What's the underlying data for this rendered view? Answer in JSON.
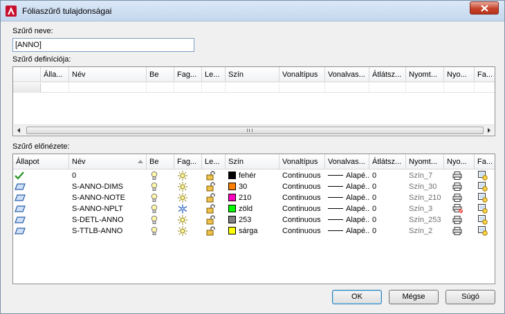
{
  "window": {
    "title": "Fóliaszűrő tulajdonságai",
    "close_icon": "close-icon",
    "app_icon": "autocad-logo-icon"
  },
  "filter_name": {
    "label": "Szűrő neve:",
    "value": "[ANNO]"
  },
  "definition": {
    "label": "Szűrő definíciója:",
    "columns": [
      "",
      "Álla...",
      "Név",
      "Be",
      "Fag...",
      "Le...",
      "Szín",
      "Vonaltípus",
      "Vonalvas...",
      "Átlátsz...",
      "Nyomt...",
      "Nyo...",
      "Fa..."
    ]
  },
  "preview": {
    "label": "Szűrő előnézete:",
    "columns": [
      "Állapot",
      "Név",
      "Be",
      "Fag...",
      "Le...",
      "Szín",
      "Vonaltípus",
      "Vonalvas...",
      "Átlátsz...",
      "Nyomt...",
      "Nyo...",
      "Fa..."
    ],
    "rows": [
      {
        "status": "current-check-icon",
        "name": "0",
        "color_hex": "#000000",
        "color": "fehér",
        "linetype": "Continuous",
        "lineweight": "Alapé...",
        "transparency": "0",
        "plot_style": "Szín_7",
        "plot": "printer-icon",
        "frozen_icon": "sun-icon"
      },
      {
        "status": "layer-icon",
        "name": "S-ANNO-DIMS",
        "color_hex": "#ff7f00",
        "color": "30",
        "linetype": "Continuous",
        "lineweight": "Alapé...",
        "transparency": "0",
        "plot_style": "Szín_30",
        "plot": "printer-icon",
        "frozen_icon": "sun-icon"
      },
      {
        "status": "layer-icon",
        "name": "S-ANNO-NOTE",
        "color_hex": "#ff00bf",
        "color": "210",
        "linetype": "Continuous",
        "lineweight": "Alapé...",
        "transparency": "0",
        "plot_style": "Szín_210",
        "plot": "printer-icon",
        "frozen_icon": "sun-icon"
      },
      {
        "status": "layer-icon",
        "name": "S-ANNO-NPLT",
        "color_hex": "#00ff00",
        "color": "zöld",
        "linetype": "Continuous",
        "lineweight": "Alapé...",
        "transparency": "0",
        "plot_style": "Szín_3",
        "plot": "no-plot-printer-icon",
        "frozen_icon": "snowflake-icon"
      },
      {
        "status": "layer-icon",
        "name": "S-DETL-ANNO",
        "color_hex": "#808080",
        "color": "253",
        "linetype": "Continuous",
        "lineweight": "Alapé...",
        "transparency": "0",
        "plot_style": "Szín_253",
        "plot": "printer-icon",
        "frozen_icon": "sun-icon"
      },
      {
        "status": "layer-icon",
        "name": "S-TTLB-ANNO",
        "color_hex": "#ffff00",
        "color": "sárga",
        "linetype": "Continuous",
        "lineweight": "Alapé...",
        "transparency": "0",
        "plot_style": "Szín_2",
        "plot": "printer-icon",
        "frozen_icon": "sun-icon"
      }
    ]
  },
  "buttons": {
    "ok": "OK",
    "cancel": "Mégse",
    "help": "Súgó"
  }
}
